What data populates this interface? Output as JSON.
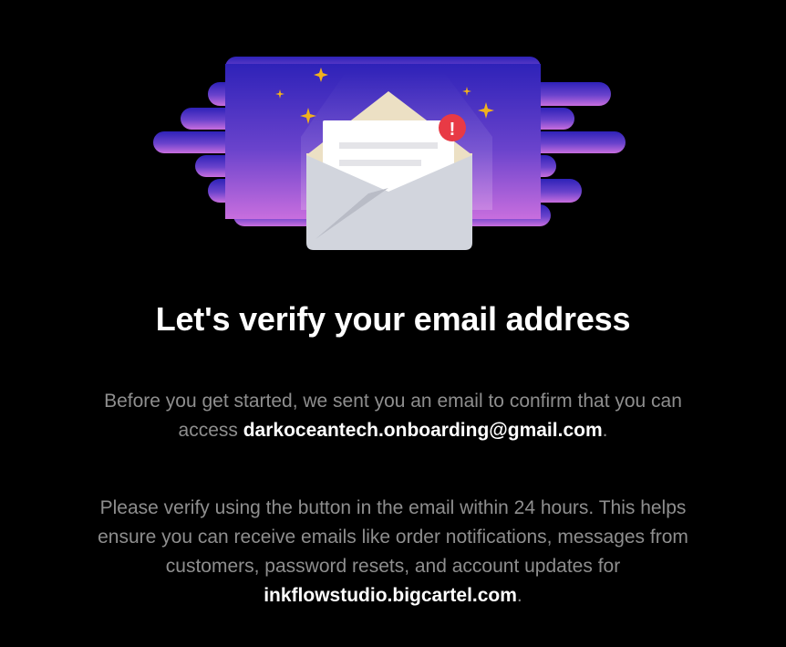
{
  "hero": {
    "alert_glyph": "!",
    "icons": [
      "envelope-icon",
      "letter-icon",
      "alert-badge-icon",
      "sparkle-icon"
    ],
    "colors": {
      "gradient_top": "#2e22b8",
      "gradient_bottom": "#c86ede",
      "envelope": "#d2d5dd",
      "sparkle": "#f2b21d",
      "alert": "#e83a45"
    }
  },
  "title": "Let's verify your email address",
  "paragraph1": {
    "before": "Before you get started, we sent you an email to confirm that you can access ",
    "email": "darkoceantech.onboarding@gmail.com",
    "after": "."
  },
  "paragraph2": {
    "before": "Please verify using the button in the email within 24 hours. This helps ensure you can receive emails like order notifications, messages from customers, password resets, and account updates for ",
    "domain": "inkflowstudio.bigcartel.com",
    "after": "."
  }
}
